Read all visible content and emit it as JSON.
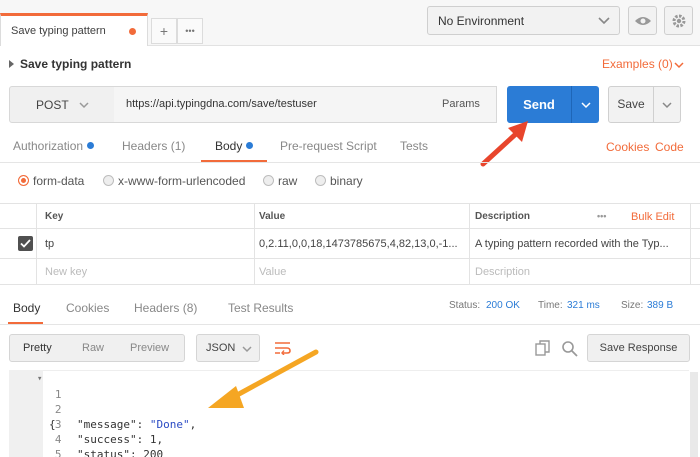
{
  "tabs": {
    "active_label": "Save typing pattern",
    "add_symbol": "+",
    "more_symbol": "•••"
  },
  "environment": {
    "selected": "No Environment"
  },
  "request": {
    "name": "Save typing pattern",
    "examples_label": "Examples (0)",
    "method": "POST",
    "url": "https://api.typingdna.com/save/testuser",
    "params_label": "Params",
    "send_label": "Send",
    "save_label": "Save"
  },
  "request_tabs": {
    "authorization": "Authorization",
    "headers": "Headers (1)",
    "body": "Body",
    "pre_request": "Pre-request Script",
    "tests": "Tests",
    "cookies": "Cookies",
    "code": "Code"
  },
  "body_types": {
    "form_data": "form-data",
    "urlencoded": "x-www-form-urlencoded",
    "raw": "raw",
    "binary": "binary",
    "selected": "form-data"
  },
  "params_table": {
    "headers": {
      "key": "Key",
      "value": "Value",
      "description": "Description",
      "more": "•••",
      "bulk_edit": "Bulk Edit"
    },
    "rows": [
      {
        "checked": true,
        "key": "tp",
        "value": "0,2.11,0,0,18,1473785675,4,82,13,0,-1...",
        "description": "A typing pattern recorded with the Typ..."
      }
    ],
    "placeholders": {
      "key": "New key",
      "value": "Value",
      "description": "Description"
    }
  },
  "response": {
    "tabs": {
      "body": "Body",
      "cookies": "Cookies",
      "headers": "Headers (8)",
      "tests": "Test Results"
    },
    "status_label": "Status:",
    "status_value": "200 OK",
    "time_label": "Time:",
    "time_value": "321 ms",
    "size_label": "Size:",
    "size_value": "389 B",
    "format_buttons": {
      "pretty": "Pretty",
      "raw": "Raw",
      "preview": "Preview"
    },
    "format_type": "JSON",
    "save_response_label": "Save Response",
    "code_lines": [
      {
        "n": "1",
        "text": "{"
      },
      {
        "n": "2",
        "key": "\"message\"",
        "sep": ": ",
        "str": "\"Done\"",
        "end": ","
      },
      {
        "n": "3",
        "key": "\"success\"",
        "sep": ": ",
        "num": "1",
        "end": ","
      },
      {
        "n": "4",
        "key": "\"status\"",
        "sep": ": ",
        "num": "200",
        "end": ""
      },
      {
        "n": "5",
        "text": "}"
      }
    ]
  },
  "colors": {
    "accent": "#f26b3a",
    "send_blue": "#2b7cd6",
    "annotation_arrow": "#e8452c"
  }
}
